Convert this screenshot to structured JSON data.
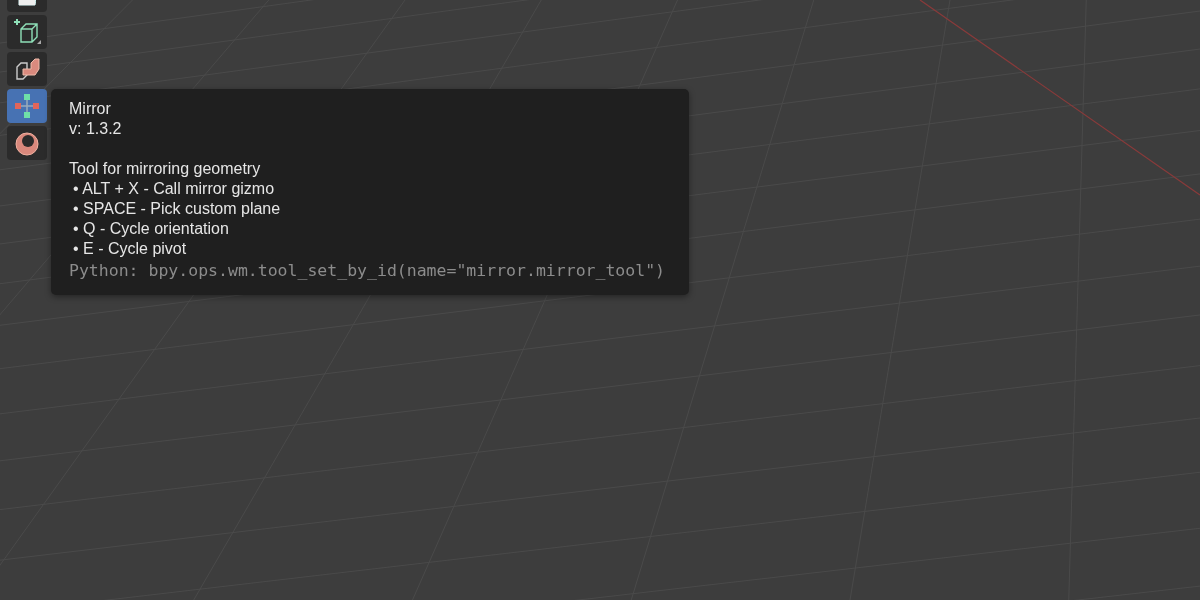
{
  "toolbar": {
    "tools": [
      {
        "kind": "measure",
        "selected": false
      },
      {
        "kind": "add-cube",
        "selected": false
      },
      {
        "kind": "extrude",
        "selected": false
      },
      {
        "kind": "mirror",
        "selected": true
      },
      {
        "kind": "torus",
        "selected": false
      }
    ]
  },
  "tooltip": {
    "title": "Mirror",
    "version": "v: 1.3.2",
    "description": "Tool for mirroring geometry",
    "shortcuts": [
      "• ALT + X - Call mirror gizmo",
      "• SPACE - Pick custom plane",
      "• Q - Cycle orientation",
      "• E - Cycle pivot"
    ],
    "python": "Python: bpy.ops.wm.tool_set_by_id(name=\"mirror.mirror_tool\")"
  }
}
